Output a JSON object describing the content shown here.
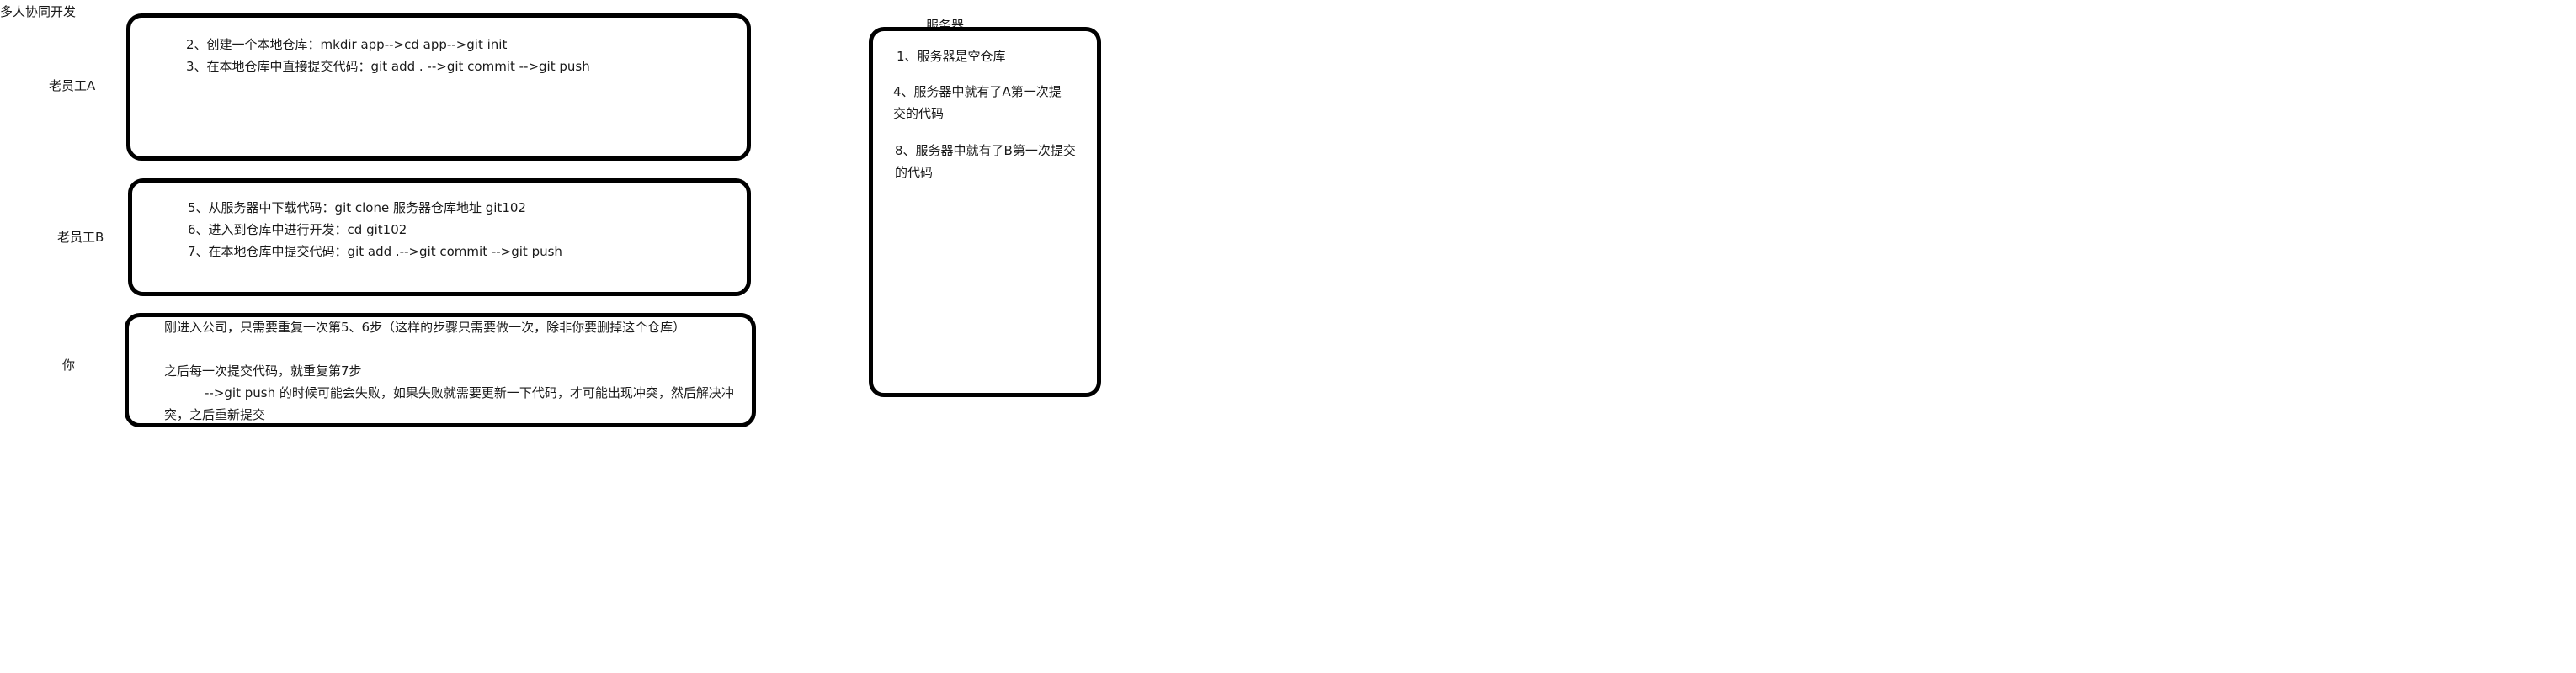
{
  "title": "多人协同开发",
  "server_label": "服务器",
  "actors": {
    "a": "老员工A",
    "b": "老员工B",
    "you": "你"
  },
  "box_a": {
    "lines": [
      "2、创建一个本地仓库：mkdir app-->cd app-->git init",
      "3、在本地仓库中直接提交代码：git add . -->git commit -->git push"
    ]
  },
  "box_b": {
    "lines": [
      "5、从服务器中下载代码：git clone 服务器仓库地址  git102",
      "6、进入到仓库中进行开发：cd git102",
      "7、在本地仓库中提交代码：git add .-->git commit -->git push"
    ]
  },
  "box_you": {
    "line1": "刚进入公司，只需要重复一次第5、6步（这样的步骤只需要做一次，除非你要删掉这个仓库）",
    "line2": "之后每一次提交代码，就重复第7步",
    "line3": "-->git push 的时候可能会失败，如果失败就需要更新一下代码，才可能出现冲突，然后解决冲",
    "line4": "突，之后重新提交"
  },
  "server_box": {
    "item1": "1、服务器是空仓库",
    "item4_line1": "4、服务器中就有了A第一次提",
    "item4_line2": "交的代码",
    "item8_line1": "8、服务器中就有了B第一次提交",
    "item8_line2": "的代码"
  }
}
